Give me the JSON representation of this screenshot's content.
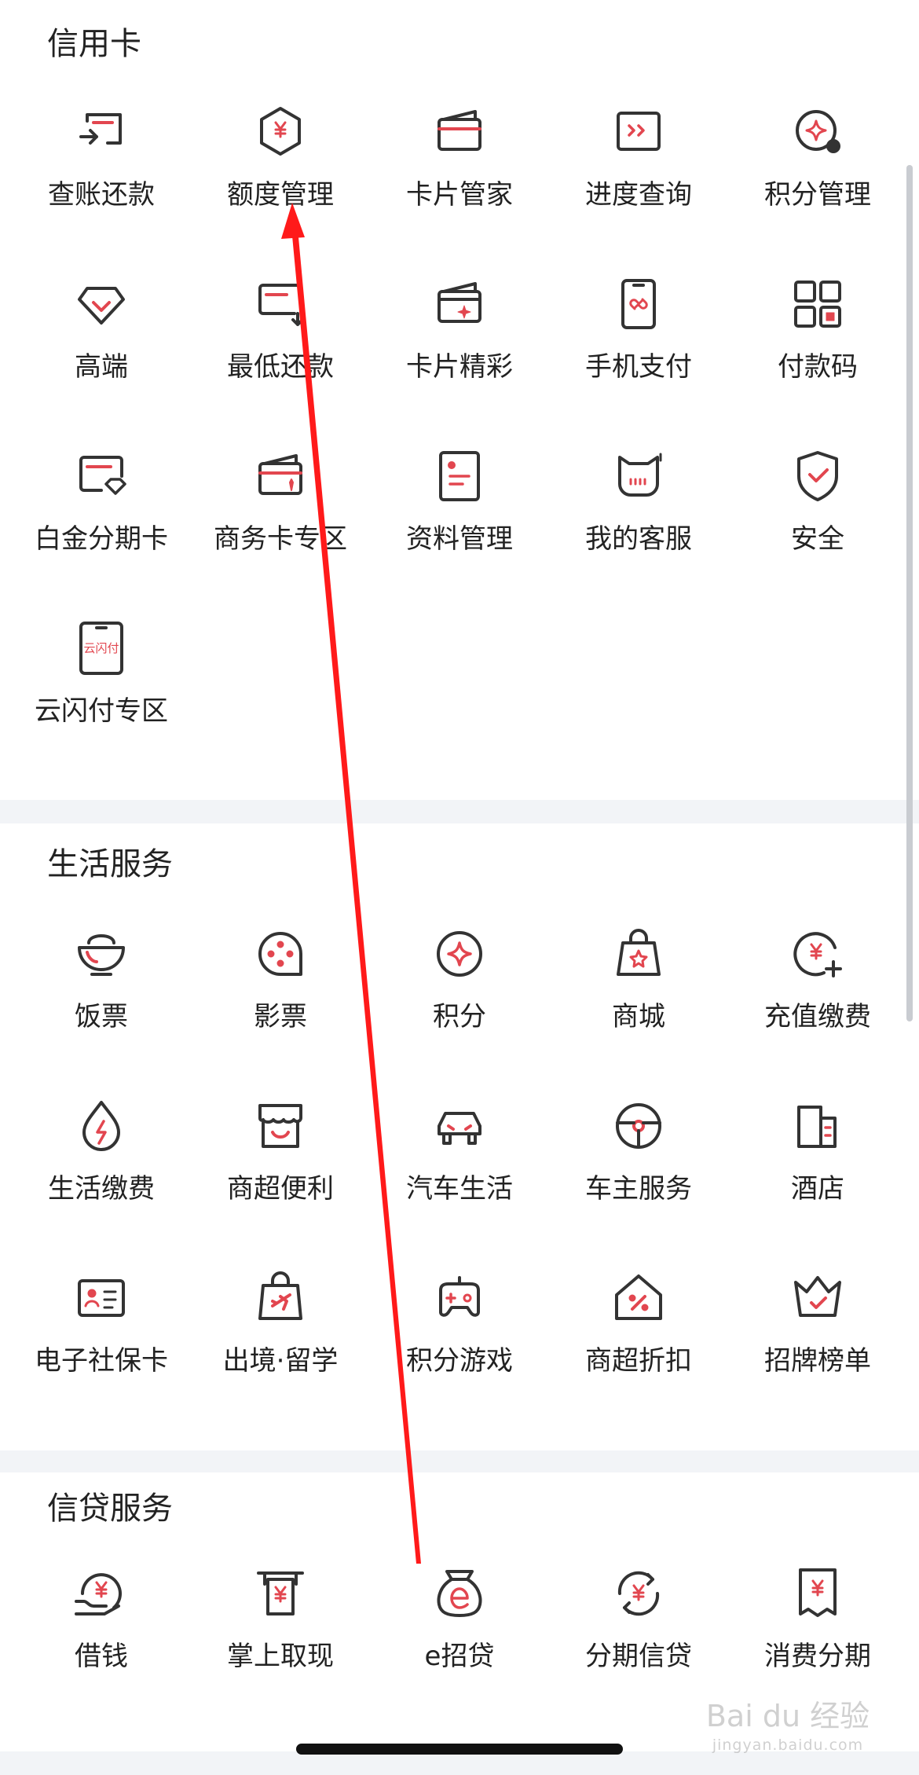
{
  "colors": {
    "accent": "#e2464f",
    "stroke": "#333333",
    "page_bg": "#f2f4f7",
    "card_bg": "#ffffff",
    "arrow": "#ff1a1a"
  },
  "credit_card": {
    "title": "信用卡",
    "items": [
      {
        "label": "查账还款",
        "icon": "bill-repay-icon"
      },
      {
        "label": "额度管理",
        "icon": "credit-limit-icon"
      },
      {
        "label": "卡片管家",
        "icon": "card-manager-icon"
      },
      {
        "label": "进度查询",
        "icon": "progress-query-icon"
      },
      {
        "label": "积分管理",
        "icon": "points-manage-icon"
      },
      {
        "label": "高端",
        "icon": "diamond-icon"
      },
      {
        "label": "最低还款",
        "icon": "min-payment-icon"
      },
      {
        "label": "卡片精彩",
        "icon": "card-highlights-icon"
      },
      {
        "label": "手机支付",
        "icon": "mobile-pay-icon"
      },
      {
        "label": "付款码",
        "icon": "payment-code-icon"
      },
      {
        "label": "白金分期卡",
        "icon": "platinum-card-icon"
      },
      {
        "label": "商务卡专区",
        "icon": "business-card-icon"
      },
      {
        "label": "资料管理",
        "icon": "profile-document-icon"
      },
      {
        "label": "我的客服",
        "icon": "customer-service-icon"
      },
      {
        "label": "安全",
        "icon": "security-shield-icon"
      },
      {
        "label": "云闪付专区",
        "icon": "quickpass-icon",
        "icon_text": "云闪付"
      }
    ]
  },
  "life_services": {
    "title": "生活服务",
    "items": [
      {
        "label": "饭票",
        "icon": "meal-bowl-icon"
      },
      {
        "label": "影票",
        "icon": "film-reel-icon"
      },
      {
        "label": "积分",
        "icon": "points-star-icon"
      },
      {
        "label": "商城",
        "icon": "shopping-bag-icon"
      },
      {
        "label": "充值缴费",
        "icon": "top-up-icon"
      },
      {
        "label": "生活缴费",
        "icon": "utility-bill-icon"
      },
      {
        "label": "商超便利",
        "icon": "store-icon"
      },
      {
        "label": "汽车生活",
        "icon": "car-icon"
      },
      {
        "label": "车主服务",
        "icon": "steering-wheel-icon"
      },
      {
        "label": "酒店",
        "icon": "hotel-icon"
      },
      {
        "label": "电子社保卡",
        "icon": "social-security-card-icon"
      },
      {
        "label": "出境·留学",
        "icon": "travel-bag-icon"
      },
      {
        "label": "积分游戏",
        "icon": "gamepad-icon"
      },
      {
        "label": "商超折扣",
        "icon": "discount-icon"
      },
      {
        "label": "招牌榜单",
        "icon": "crown-icon"
      }
    ]
  },
  "credit_services": {
    "title": "信贷服务",
    "items": [
      {
        "label": "借钱",
        "icon": "borrow-money-icon"
      },
      {
        "label": "掌上取现",
        "icon": "cash-withdraw-icon"
      },
      {
        "label": "e招贷",
        "icon": "money-bag-icon"
      },
      {
        "label": "分期信贷",
        "icon": "installment-loan-icon"
      },
      {
        "label": "消费分期",
        "icon": "consumer-installment-icon"
      }
    ]
  },
  "watermark": {
    "brand": "Bai du 经验",
    "url": "jingyan.baidu.com"
  }
}
